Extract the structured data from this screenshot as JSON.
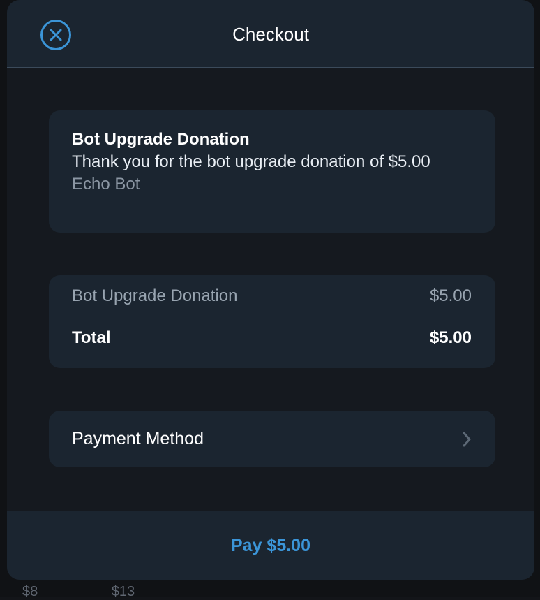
{
  "header": {
    "title": "Checkout",
    "close_icon": "close-circle-icon"
  },
  "invoice": {
    "title": "Bot Upgrade Donation",
    "description": "Thank you for the bot upgrade donation of $5.00",
    "bot_name": "Echo Bot"
  },
  "summary": {
    "item_label": "Bot Upgrade Donation",
    "item_price": "$5.00",
    "total_label": "Total",
    "total_price": "$5.00"
  },
  "payment": {
    "label": "Payment Method",
    "icon": "chevron-right-icon"
  },
  "footer": {
    "pay_label": "Pay $5.00"
  },
  "background": {
    "prices": [
      "$8",
      "$13"
    ]
  },
  "colors": {
    "accent": "#3b95d8",
    "card": "#1b2530",
    "background": "#15191f"
  }
}
